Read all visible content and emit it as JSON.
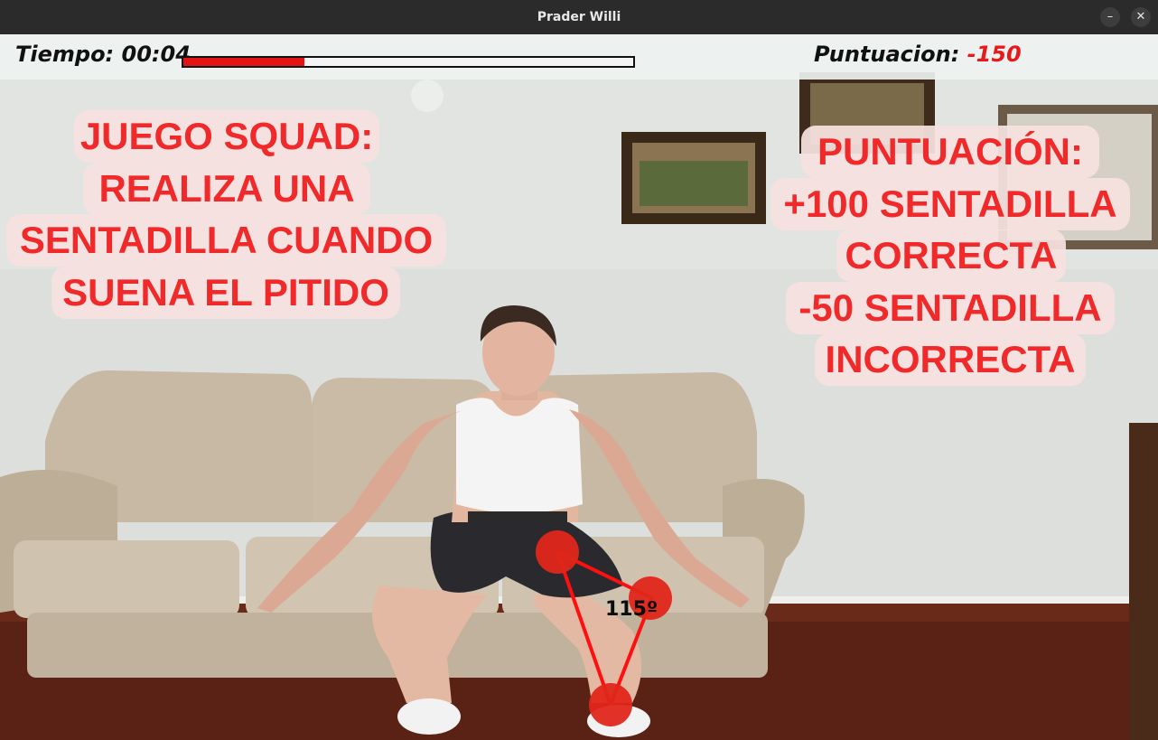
{
  "window": {
    "title": "Prader Willi",
    "minimize_glyph": "–",
    "close_glyph": "✕"
  },
  "hud": {
    "time_label": "Tiempo:",
    "time_value": "00:04",
    "progress_fraction": 0.27,
    "score_label": "Puntuacion:",
    "score_value": "-150"
  },
  "instructions_left": {
    "lines": [
      "JUEGO SQUAD:",
      "REALIZA UNA",
      "SENTADILLA CUANDO",
      "SUENA EL PITIDO"
    ]
  },
  "instructions_right": {
    "lines": [
      "PUNTUACIÓN:",
      "+100 SENTADILLA",
      "CORRECTA",
      "-50 SENTADILLA",
      "INCORRECTA"
    ]
  },
  "pose": {
    "angle_label": "115º"
  },
  "colors": {
    "accent_red": "#e61a1a",
    "panel_bg": "#f6e2e0",
    "joint_red": "#e0261a"
  }
}
